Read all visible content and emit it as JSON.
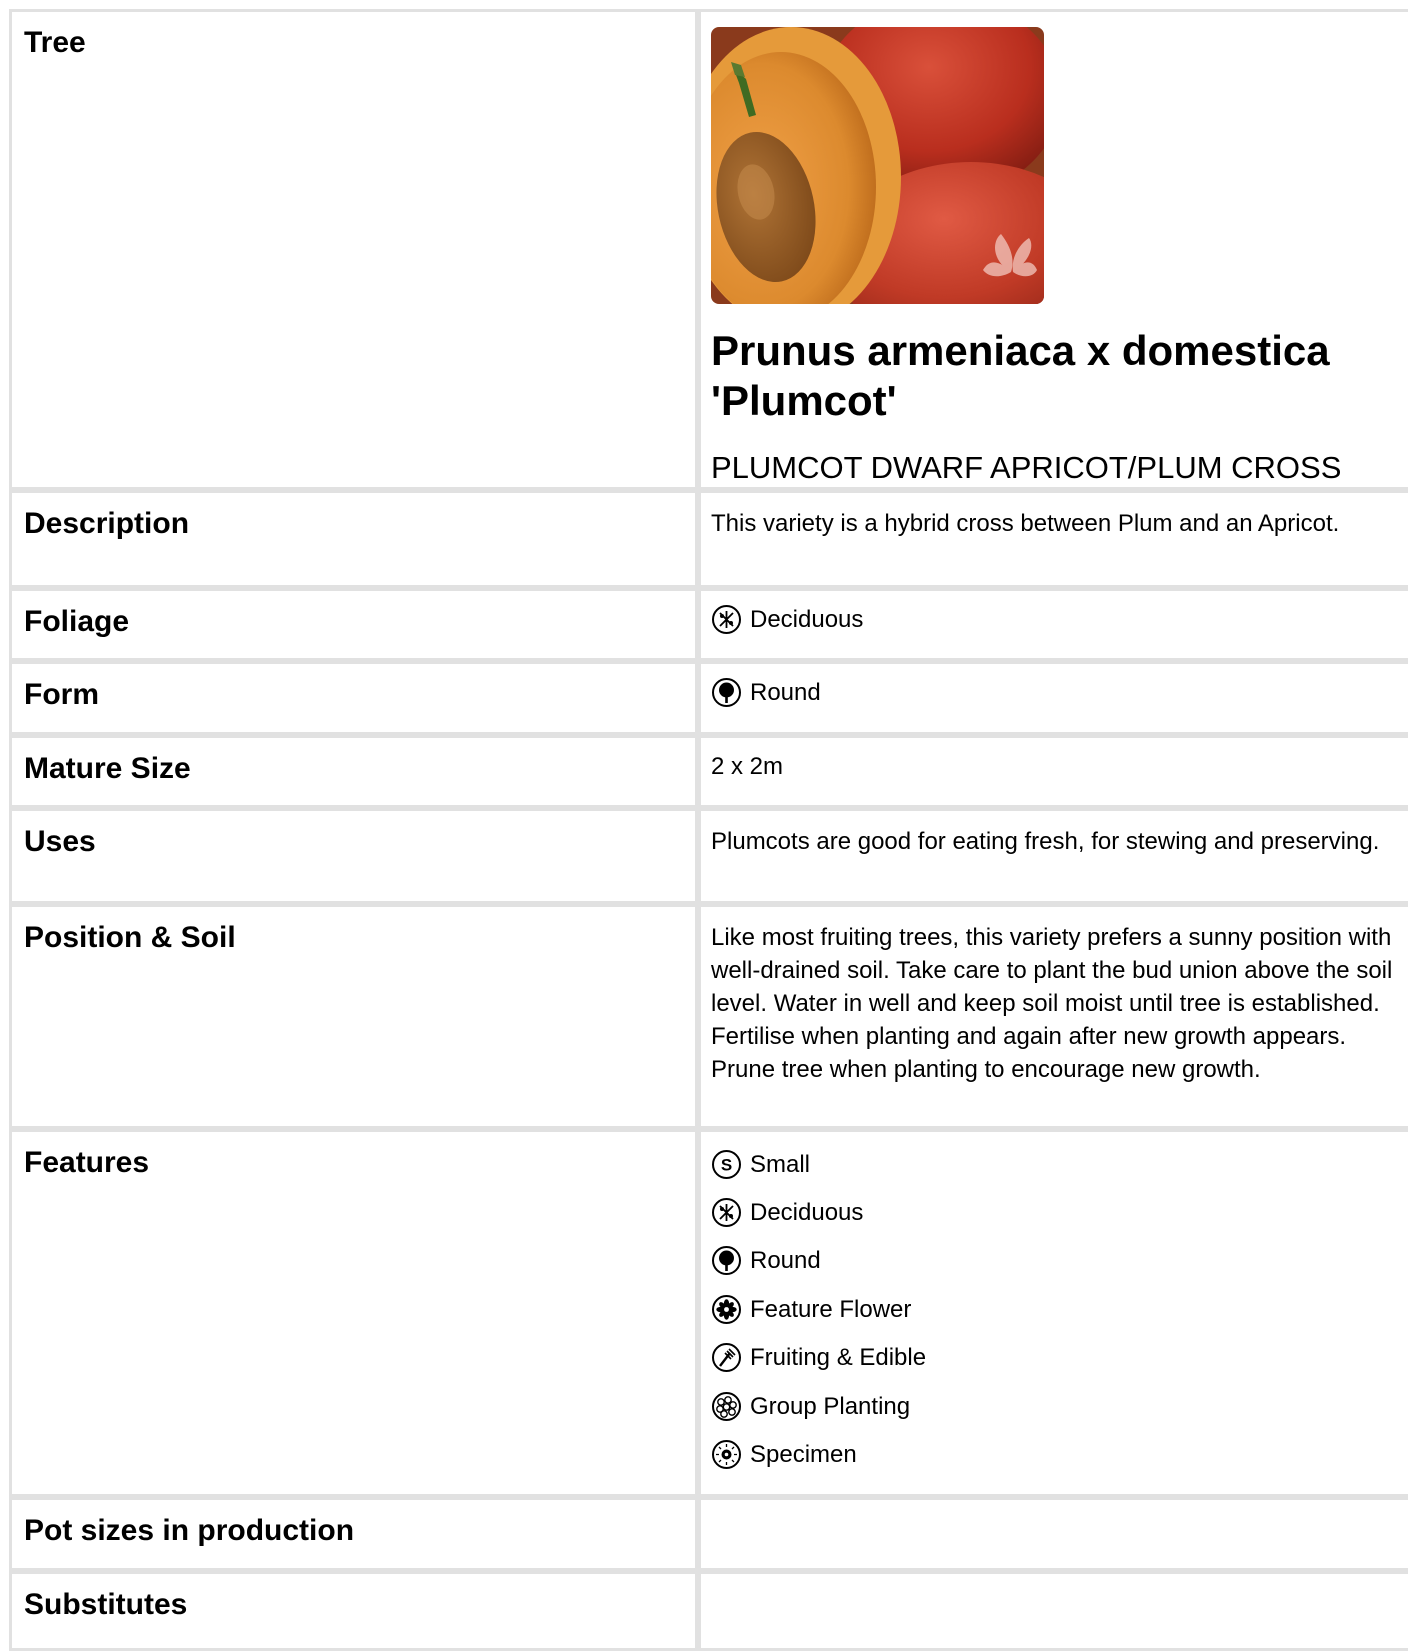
{
  "rows": {
    "tree": {
      "label": "Tree"
    },
    "description": {
      "label": "Description",
      "value": "This variety is a hybrid cross between Plum and an Apricot."
    },
    "foliage": {
      "label": "Foliage",
      "value": "Deciduous",
      "icon": "deciduous-icon"
    },
    "form": {
      "label": "Form",
      "value": "Round",
      "icon": "round-icon"
    },
    "mature_size": {
      "label": "Mature Size",
      "value": "2 x 2m"
    },
    "uses": {
      "label": "Uses",
      "value": "Plumcots are good for eating fresh, for stewing and preserving."
    },
    "position_soil": {
      "label": "Position & Soil",
      "value": "Like most fruiting trees, this variety prefers a sunny position with well-drained soil. Take care to plant the bud union above the soil level. Water in well and keep soil moist until tree is established. Fertilise when planting and again after new growth appears. Prune tree when planting to encourage new growth."
    },
    "features": {
      "label": "Features",
      "items": [
        {
          "label": "Small",
          "icon": "small-icon"
        },
        {
          "label": "Deciduous",
          "icon": "deciduous-icon"
        },
        {
          "label": "Round",
          "icon": "round-icon"
        },
        {
          "label": "Feature Flower",
          "icon": "flower-icon"
        },
        {
          "label": "Fruiting & Edible",
          "icon": "fork-icon"
        },
        {
          "label": "Group Planting",
          "icon": "group-planting-icon"
        },
        {
          "label": "Specimen",
          "icon": "specimen-icon"
        }
      ]
    },
    "pot_sizes": {
      "label": "Pot sizes in production",
      "value": ""
    },
    "substitutes": {
      "label": "Substitutes",
      "value": ""
    }
  },
  "plant": {
    "botanical_name": "Prunus armeniaca x domestica 'Plumcot'",
    "common_name": "PLUMCOT DWARF APRICOT/PLUM CROSS",
    "photo": "apricot-plum-photo"
  },
  "colors": {
    "grid": "#e1e1e1",
    "text": "#000000"
  }
}
